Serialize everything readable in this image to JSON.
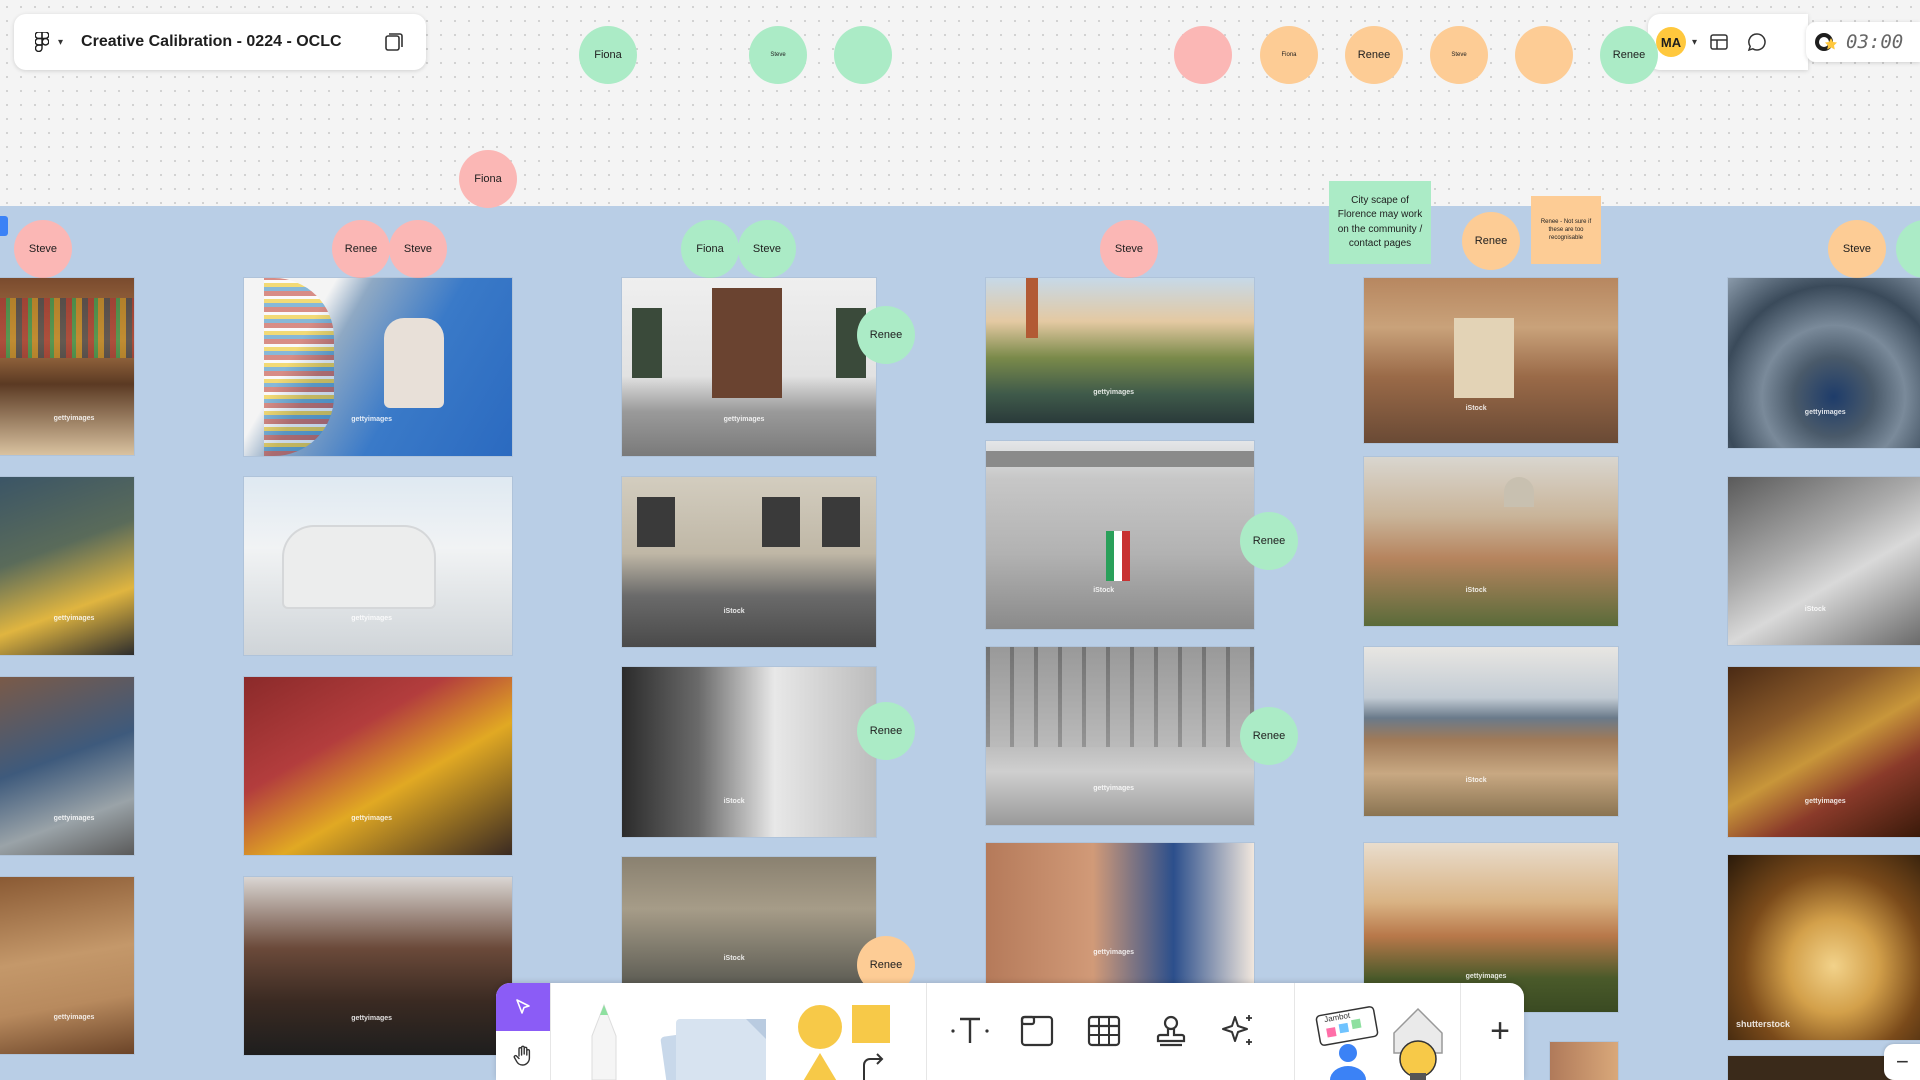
{
  "file": {
    "title": "Creative Calibration - 0224 - OCLC"
  },
  "user": {
    "initials": "MA"
  },
  "timer": {
    "value": "03:00"
  },
  "stamps": {
    "fiona": "Fiona",
    "steve": "Steve",
    "renee": "Renee"
  },
  "notes": {
    "cityscape": "City scape of Florence may work on the community / contact pages",
    "renee_note": "Renee - Not sure if these are too recognisable"
  },
  "photo_credits": {
    "getty": "gettyimages",
    "istock": "iStock",
    "shutterstock": "shutterstock"
  },
  "colors": {
    "canvas": "#f4f4f4",
    "section": "#b9cee6",
    "sticker_green": "#abebc6",
    "sticker_pink": "#fbb7b5",
    "sticker_orange": "#fdcc95",
    "accent": "#8b5cf6"
  },
  "toolbar": {
    "stamp_label": "Jambot",
    "zoom_out": "−",
    "add": "+"
  }
}
